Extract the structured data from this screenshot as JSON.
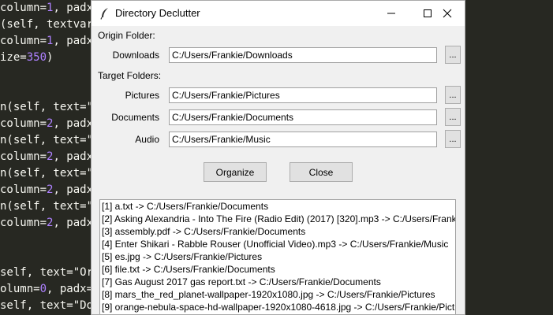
{
  "editor": {
    "lines": [
      {
        "parts": [
          {
            "t": "column=",
            "c": "tok-plain"
          },
          {
            "t": "1",
            "c": "tok-num"
          },
          {
            "t": ", padx=",
            "c": "tok-plain"
          }
        ]
      },
      {
        "parts": [
          {
            "t": "(self, textvari",
            "c": "tok-plain"
          }
        ]
      },
      {
        "parts": [
          {
            "t": "column=",
            "c": "tok-plain"
          },
          {
            "t": "1",
            "c": "tok-num"
          },
          {
            "t": ", padx=",
            "c": "tok-plain"
          }
        ]
      },
      {
        "parts": [
          {
            "t": "ize=",
            "c": "tok-plain"
          },
          {
            "t": "350",
            "c": "tok-num"
          },
          {
            "t": ")",
            "c": "tok-plain"
          }
        ]
      },
      {
        "parts": []
      },
      {
        "parts": []
      },
      {
        "parts": [
          {
            "t": "n(self, text=\".",
            "c": "tok-plain"
          }
        ]
      },
      {
        "parts": [
          {
            "t": "column=",
            "c": "tok-plain"
          },
          {
            "t": "2",
            "c": "tok-num"
          },
          {
            "t": ", padx=",
            "c": "tok-plain"
          }
        ]
      },
      {
        "parts": [
          {
            "t": "n(self, text=\".",
            "c": "tok-plain"
          }
        ]
      },
      {
        "parts": [
          {
            "t": "column=",
            "c": "tok-plain"
          },
          {
            "t": "2",
            "c": "tok-num"
          },
          {
            "t": ", padx=",
            "c": "tok-plain"
          }
        ]
      },
      {
        "parts": [
          {
            "t": "n(self, text=\".",
            "c": "tok-plain"
          }
        ]
      },
      {
        "parts": [
          {
            "t": "column=",
            "c": "tok-plain"
          },
          {
            "t": "2",
            "c": "tok-num"
          },
          {
            "t": ", padx=",
            "c": "tok-plain"
          }
        ]
      },
      {
        "parts": [
          {
            "t": "n(self, text=\".",
            "c": "tok-plain"
          }
        ]
      },
      {
        "parts": [
          {
            "t": "column=",
            "c": "tok-plain"
          },
          {
            "t": "2",
            "c": "tok-num"
          },
          {
            "t": ", padx=",
            "c": "tok-plain"
          }
        ]
      },
      {
        "parts": []
      },
      {
        "parts": []
      },
      {
        "parts": [
          {
            "t": "self, text=\"Ori",
            "c": "tok-plain"
          }
        ]
      },
      {
        "parts": [
          {
            "t": "olumn=",
            "c": "tok-plain"
          },
          {
            "t": "0",
            "c": "tok-num"
          },
          {
            "t": ", padx=",
            "c": "tok-plain"
          },
          {
            "t": "5",
            "c": "tok-num"
          }
        ]
      },
      {
        "parts": [
          {
            "t": "self, text=\"Dow",
            "c": "tok-plain"
          }
        ]
      }
    ]
  },
  "window": {
    "title": "Directory Declutter",
    "origin_label": "Origin Folder:",
    "target_label": "Target Folders:",
    "rows": [
      {
        "label": "Downloads",
        "value": "C:/Users/Frankie/Downloads",
        "browse": "..."
      },
      {
        "label": "Pictures",
        "value": "C:/Users/Frankie/Pictures",
        "browse": "..."
      },
      {
        "label": "Documents",
        "value": "C:/Users/Frankie/Documents",
        "browse": "..."
      },
      {
        "label": "Audio",
        "value": "C:/Users/Frankie/Music",
        "browse": "..."
      }
    ],
    "organize_label": "Organize",
    "close_label": "Close",
    "log": [
      "[1] a.txt -> C:/Users/Frankie/Documents",
      "[2] Asking Alexandria - Into The Fire (Radio Edit) (2017) [320].mp3 -> C:/Users/Frankie/",
      "[3] assembly.pdf -> C:/Users/Frankie/Documents",
      "[4] Enter Shikari - Rabble Rouser (Unofficial Video).mp3 -> C:/Users/Frankie/Music",
      "[5] es.jpg -> C:/Users/Frankie/Pictures",
      "[6] file.txt -> C:/Users/Frankie/Documents",
      "[7] Gas August 2017 gas report.txt -> C:/Users/Frankie/Documents",
      "[8] mars_the_red_planet-wallpaper-1920x1080.jpg -> C:/Users/Frankie/Pictures",
      "[9] orange-nebula-space-hd-wallpaper-1920x1080-4618.jpg -> C:/Users/Frankie/Pictu"
    ]
  }
}
